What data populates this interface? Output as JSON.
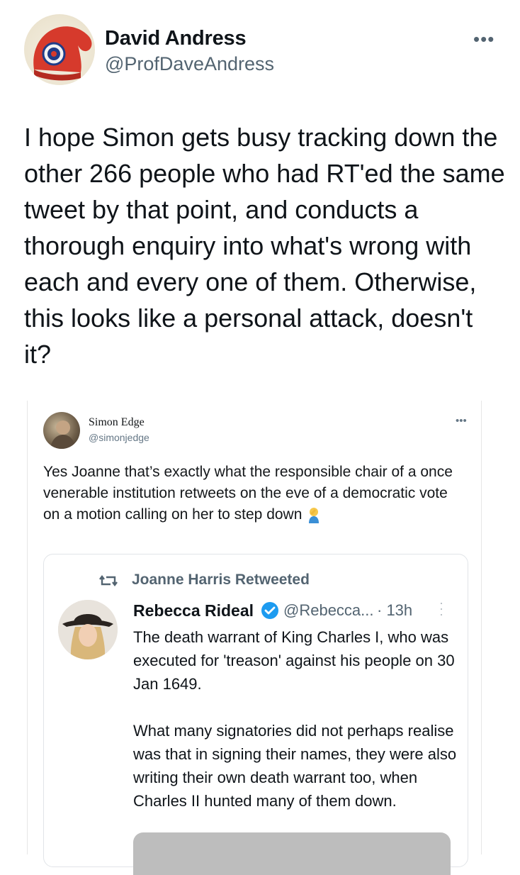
{
  "tweet": {
    "author_name": "David Andress",
    "author_handle": "@ProfDaveAndress",
    "more_icon": "more-horizontal-icon",
    "text": "I hope Simon gets busy tracking down the other 266 people who had RT'ed the same tweet by that point, and conducts a thorough enquiry into what's wrong with each and every one of them. Otherwise, this looks like a personal attack, doesn't it?"
  },
  "embedded": {
    "author_name": "Simon Edge",
    "author_handle": "@simonjedge",
    "text": "Yes Joanne that’s exactly what the responsible chair of a once venerable institution retweets on the eve of a democratic vote on a motion calling on her to step down",
    "emoji": "facepalm-emoji",
    "quoted": {
      "retweet_label": "Joanne Harris Retweeted",
      "author_name": "Rebecca Rideal",
      "author_handle": "@Rebecca...",
      "time": "· 13h",
      "text": "The death warrant of King Charles I, who was executed for 'treason' against his people on 30 Jan 1649.\n\nWhat many signatories did not perhaps realise was that in signing their names, they were also writing their own death warrant too, when Charles II hunted many of them down."
    }
  },
  "colors": {
    "text": "#0f1419",
    "secondary": "#536471",
    "verified": "#1d9bf0"
  }
}
